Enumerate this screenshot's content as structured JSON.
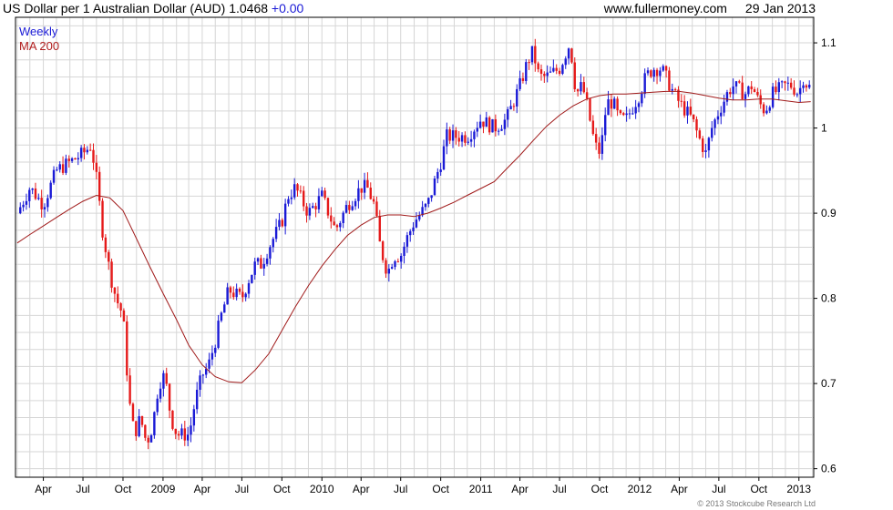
{
  "header": {
    "title": "US Dollar per 1 Australian Dollar (AUD)",
    "last_value": "1.0468",
    "change": "+0.00",
    "site": "www.fullermoney.com",
    "date": "29 Jan 2013"
  },
  "legend": {
    "series_label": "Weekly",
    "ma_label": "MA 200"
  },
  "copyright": "© 2013 Stockcube Research Ltd",
  "colors": {
    "up": "#1a1ad6",
    "down": "#e51a1a",
    "ma": "#a01a1a",
    "grid": "#d6d6d6",
    "frame": "#000000"
  },
  "chart_data": {
    "type": "line",
    "title": "US Dollar per 1 Australian Dollar (AUD)",
    "xlabel": "",
    "ylabel": "",
    "ylim": [
      0.59,
      1.13
    ],
    "y_ticks": [
      0.6,
      0.7,
      0.8,
      0.9,
      1,
      1.1
    ],
    "y_tick_labels": [
      "0.6",
      "0.7",
      "0.8",
      "0.9",
      "1",
      "1.1"
    ],
    "x_ticks": [
      "2008-04-01",
      "2008-07-01",
      "2008-10-01",
      "2009-01-01",
      "2009-04-01",
      "2009-07-01",
      "2009-10-01",
      "2010-01-01",
      "2010-04-01",
      "2010-07-01",
      "2010-10-01",
      "2011-01-01",
      "2011-04-01",
      "2011-07-01",
      "2011-10-01",
      "2012-01-01",
      "2012-04-01",
      "2012-07-01",
      "2012-10-01",
      "2013-01-01"
    ],
    "x_tick_labels": [
      "Apr",
      "Jul",
      "Oct",
      "2009",
      "Apr",
      "Jul",
      "Oct",
      "2010",
      "Apr",
      "Jul",
      "Oct",
      "2011",
      "Apr",
      "Jul",
      "Oct",
      "2012",
      "Apr",
      "Jul",
      "Oct",
      "2013"
    ],
    "xlim": [
      "2008-01-28",
      "2013-02-04"
    ],
    "grid": true,
    "legend_position": "top-left",
    "series": [
      {
        "name": "Weekly",
        "style": "weekly candlesticks (close values approximated)",
        "points": [
          [
            "2008-02-01",
            0.9
          ],
          [
            "2008-03-01",
            0.93
          ],
          [
            "2008-04-01",
            0.91
          ],
          [
            "2008-05-01",
            0.95
          ],
          [
            "2008-06-01",
            0.96
          ],
          [
            "2008-07-01",
            0.97
          ],
          [
            "2008-07-20",
            0.98
          ],
          [
            "2008-08-01",
            0.94
          ],
          [
            "2008-08-15",
            0.88
          ],
          [
            "2008-09-01",
            0.83
          ],
          [
            "2008-09-15",
            0.8
          ],
          [
            "2008-10-01",
            0.78
          ],
          [
            "2008-10-15",
            0.68
          ],
          [
            "2008-10-27",
            0.64
          ],
          [
            "2008-11-10",
            0.66
          ],
          [
            "2008-11-24",
            0.63
          ],
          [
            "2008-12-08",
            0.65
          ],
          [
            "2008-12-22",
            0.7
          ],
          [
            "2009-01-05",
            0.71
          ],
          [
            "2009-01-19",
            0.66
          ],
          [
            "2009-02-02",
            0.64
          ],
          [
            "2009-02-16",
            0.64
          ],
          [
            "2009-03-02",
            0.64
          ],
          [
            "2009-03-16",
            0.68
          ],
          [
            "2009-04-01",
            0.71
          ],
          [
            "2009-04-15",
            0.72
          ],
          [
            "2009-05-01",
            0.75
          ],
          [
            "2009-05-15",
            0.78
          ],
          [
            "2009-06-01",
            0.81
          ],
          [
            "2009-07-01",
            0.8
          ],
          [
            "2009-07-15",
            0.82
          ],
          [
            "2009-08-01",
            0.84
          ],
          [
            "2009-08-15",
            0.84
          ],
          [
            "2009-09-01",
            0.86
          ],
          [
            "2009-10-01",
            0.89
          ],
          [
            "2009-10-15",
            0.92
          ],
          [
            "2009-11-01",
            0.93
          ],
          [
            "2009-12-01",
            0.9
          ],
          [
            "2010-01-01",
            0.92
          ],
          [
            "2010-02-01",
            0.88
          ],
          [
            "2010-03-01",
            0.91
          ],
          [
            "2010-04-01",
            0.93
          ],
          [
            "2010-04-15",
            0.93
          ],
          [
            "2010-05-01",
            0.91
          ],
          [
            "2010-05-15",
            0.86
          ],
          [
            "2010-06-01",
            0.83
          ],
          [
            "2010-06-15",
            0.85
          ],
          [
            "2010-07-01",
            0.85
          ],
          [
            "2010-07-15",
            0.87
          ],
          [
            "2010-08-01",
            0.89
          ],
          [
            "2010-09-01",
            0.91
          ],
          [
            "2010-10-01",
            0.96
          ],
          [
            "2010-10-15",
            0.99
          ],
          [
            "2010-11-01",
            0.99
          ],
          [
            "2010-12-01",
            0.99
          ],
          [
            "2011-01-01",
            1.01
          ],
          [
            "2011-02-01",
            1.0
          ],
          [
            "2011-03-01",
            1.01
          ],
          [
            "2011-04-01",
            1.05
          ],
          [
            "2011-04-20",
            1.08
          ],
          [
            "2011-05-01",
            1.09
          ],
          [
            "2011-05-15",
            1.06
          ],
          [
            "2011-06-01",
            1.06
          ],
          [
            "2011-07-01",
            1.07
          ],
          [
            "2011-07-25",
            1.1
          ],
          [
            "2011-08-08",
            1.04
          ],
          [
            "2011-08-22",
            1.05
          ],
          [
            "2011-09-01",
            1.03
          ],
          [
            "2011-09-20",
            0.98
          ],
          [
            "2011-10-03",
            0.97
          ],
          [
            "2011-10-17",
            1.03
          ],
          [
            "2011-11-01",
            1.03
          ],
          [
            "2011-11-15",
            1.01
          ],
          [
            "2011-12-01",
            1.01
          ],
          [
            "2012-01-01",
            1.04
          ],
          [
            "2012-01-15",
            1.06
          ],
          [
            "2012-02-01",
            1.07
          ],
          [
            "2012-02-20",
            1.07
          ],
          [
            "2012-03-01",
            1.06
          ],
          [
            "2012-03-20",
            1.04
          ],
          [
            "2012-04-01",
            1.03
          ],
          [
            "2012-05-01",
            1.01
          ],
          [
            "2012-05-15",
            0.99
          ],
          [
            "2012-06-01",
            0.97
          ],
          [
            "2012-06-15",
            1.0
          ],
          [
            "2012-07-01",
            1.02
          ],
          [
            "2012-07-20",
            1.04
          ],
          [
            "2012-08-01",
            1.05
          ],
          [
            "2012-09-01",
            1.04
          ],
          [
            "2012-09-15",
            1.05
          ],
          [
            "2012-10-01",
            1.03
          ],
          [
            "2012-10-15",
            1.02
          ],
          [
            "2012-11-01",
            1.04
          ],
          [
            "2012-12-01",
            1.05
          ],
          [
            "2012-12-15",
            1.05
          ],
          [
            "2013-01-01",
            1.04
          ],
          [
            "2013-01-10",
            1.06
          ],
          [
            "2013-01-20",
            1.05
          ],
          [
            "2013-01-28",
            1.0468
          ]
        ]
      },
      {
        "name": "MA 200",
        "style": "line",
        "points": [
          [
            "2008-02-01",
            0.865
          ],
          [
            "2008-03-01",
            0.875
          ],
          [
            "2008-04-01",
            0.885
          ],
          [
            "2008-05-01",
            0.895
          ],
          [
            "2008-06-01",
            0.905
          ],
          [
            "2008-07-01",
            0.914
          ],
          [
            "2008-08-01",
            0.921
          ],
          [
            "2008-09-01",
            0.918
          ],
          [
            "2008-10-01",
            0.903
          ],
          [
            "2008-11-01",
            0.87
          ],
          [
            "2008-12-01",
            0.838
          ],
          [
            "2009-01-01",
            0.806
          ],
          [
            "2009-02-01",
            0.775
          ],
          [
            "2009-03-01",
            0.745
          ],
          [
            "2009-04-01",
            0.722
          ],
          [
            "2009-05-01",
            0.708
          ],
          [
            "2009-06-01",
            0.702
          ],
          [
            "2009-07-01",
            0.701
          ],
          [
            "2009-08-01",
            0.716
          ],
          [
            "2009-09-01",
            0.735
          ],
          [
            "2009-10-01",
            0.762
          ],
          [
            "2009-11-01",
            0.79
          ],
          [
            "2009-12-01",
            0.815
          ],
          [
            "2010-01-01",
            0.838
          ],
          [
            "2010-02-01",
            0.858
          ],
          [
            "2010-03-01",
            0.874
          ],
          [
            "2010-04-01",
            0.886
          ],
          [
            "2010-05-01",
            0.895
          ],
          [
            "2010-06-01",
            0.898
          ],
          [
            "2010-07-01",
            0.898
          ],
          [
            "2010-08-01",
            0.896
          ],
          [
            "2010-09-01",
            0.9
          ],
          [
            "2010-10-01",
            0.906
          ],
          [
            "2010-11-01",
            0.913
          ],
          [
            "2010-12-01",
            0.921
          ],
          [
            "2011-01-01",
            0.929
          ],
          [
            "2011-02-01",
            0.937
          ],
          [
            "2011-03-01",
            0.952
          ],
          [
            "2011-04-01",
            0.968
          ],
          [
            "2011-05-01",
            0.985
          ],
          [
            "2011-06-01",
            1.002
          ],
          [
            "2011-07-01",
            1.015
          ],
          [
            "2011-08-01",
            1.026
          ],
          [
            "2011-09-01",
            1.034
          ],
          [
            "2011-10-01",
            1.038
          ],
          [
            "2011-11-01",
            1.04
          ],
          [
            "2011-12-01",
            1.04
          ],
          [
            "2012-01-01",
            1.041
          ],
          [
            "2012-02-01",
            1.042
          ],
          [
            "2012-03-01",
            1.043
          ],
          [
            "2012-04-01",
            1.043
          ],
          [
            "2012-05-01",
            1.041
          ],
          [
            "2012-06-01",
            1.038
          ],
          [
            "2012-07-01",
            1.035
          ],
          [
            "2012-08-01",
            1.033
          ],
          [
            "2012-09-01",
            1.033
          ],
          [
            "2012-10-01",
            1.034
          ],
          [
            "2012-11-01",
            1.034
          ],
          [
            "2012-12-01",
            1.032
          ],
          [
            "2013-01-01",
            1.03
          ],
          [
            "2013-01-28",
            1.031
          ]
        ]
      }
    ]
  }
}
